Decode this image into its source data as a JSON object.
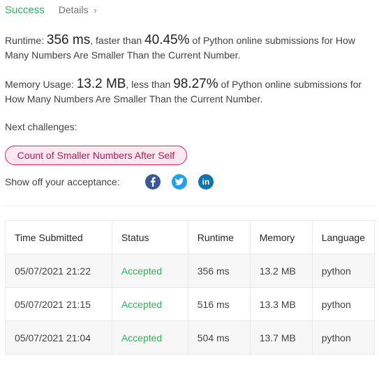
{
  "header": {
    "status": "Success",
    "details_label": "Details",
    "details_chevron": "›"
  },
  "runtime": {
    "label": "Runtime:",
    "value": "356 ms",
    "middle": ", faster than",
    "percent": "40.45%",
    "tail": "of Python online submissions for How Many Numbers Are Smaller Than the Current Number."
  },
  "memory": {
    "label": "Memory Usage:",
    "value": "13.2 MB",
    "middle": ", less than",
    "percent": "98.27%",
    "tail": "of Python online submissions for How Many Numbers Are Smaller Than the Current Number."
  },
  "next_challenges": {
    "label": "Next challenges:",
    "items": [
      "Count of Smaller Numbers After Self"
    ]
  },
  "share": {
    "label": "Show off your acceptance:",
    "icons": [
      "facebook-icon",
      "twitter-icon",
      "linkedin-icon"
    ]
  },
  "table": {
    "headers": [
      "Time Submitted",
      "Status",
      "Runtime",
      "Memory",
      "Language"
    ],
    "rows": [
      [
        "05/07/2021 21:22",
        "Accepted",
        "356 ms",
        "13.2 MB",
        "python"
      ],
      [
        "05/07/2021 21:15",
        "Accepted",
        "516 ms",
        "13.3 MB",
        "python"
      ],
      [
        "05/07/2021 21:04",
        "Accepted",
        "504 ms",
        "13.7 MB",
        "python"
      ]
    ]
  },
  "colors": {
    "success": "#2db55d",
    "challenge_border": "#e91e63",
    "challenge_bg": "#fde8ef",
    "facebook": "#3b5998",
    "twitter": "#1da1f2",
    "linkedin": "#0e76a8"
  }
}
